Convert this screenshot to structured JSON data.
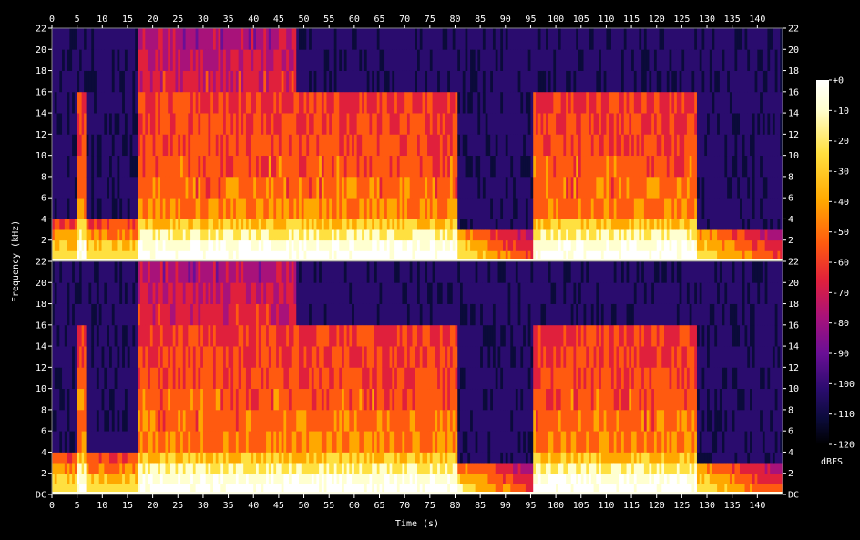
{
  "chart_data": {
    "type": "heatmap",
    "title": "",
    "xlabel": "Time (s)",
    "ylabel": "Frequency (kHz)",
    "colorbar_label": "dBFS",
    "xlim": [
      0,
      145
    ],
    "ylim_khz": [
      0,
      22
    ],
    "x_ticks": [
      0,
      5,
      10,
      15,
      20,
      25,
      30,
      35,
      40,
      45,
      50,
      55,
      60,
      65,
      70,
      75,
      80,
      85,
      90,
      95,
      100,
      105,
      110,
      115,
      120,
      125,
      130,
      135,
      140
    ],
    "y_tick_labels": [
      "DC",
      "2",
      "4",
      "6",
      "8",
      "10",
      "12",
      "14",
      "16",
      "18",
      "20",
      "22"
    ],
    "colorbar_ticks": [
      "+0",
      "-10",
      "-20",
      "-30",
      "-40",
      "-50",
      "-60",
      "-70",
      "-80",
      "-90",
      "-100",
      "-110",
      "-120"
    ],
    "colorbar_range_db": [
      -120,
      0
    ],
    "channels": 2,
    "colormap": [
      "#000000",
      "#0b0b3a",
      "#2a0c6e",
      "#6a0f96",
      "#a8127a",
      "#e0203c",
      "#ff5a10",
      "#ffa800",
      "#ffe040",
      "#ffffd0",
      "#ffffff"
    ],
    "segments": [
      {
        "start_s": 0,
        "end_s": 5,
        "bandwidth_khz": 3.8,
        "level": "quiet"
      },
      {
        "start_s": 5,
        "end_s": 6.8,
        "bandwidth_khz": 16,
        "level": "loud"
      },
      {
        "start_s": 6.8,
        "end_s": 17,
        "bandwidth_khz": 4,
        "level": "quiet"
      },
      {
        "start_s": 17,
        "end_s": 48.5,
        "bandwidth_khz": 22,
        "level": "loud"
      },
      {
        "start_s": 48.5,
        "end_s": 80.5,
        "bandwidth_khz": 16,
        "level": "loud"
      },
      {
        "start_s": 80.5,
        "end_s": 95.5,
        "bandwidth_khz": 3,
        "level": "fade"
      },
      {
        "start_s": 95.5,
        "end_s": 128,
        "bandwidth_khz": 16,
        "level": "loud"
      },
      {
        "start_s": 128,
        "end_s": 145,
        "bandwidth_khz": 2.5,
        "level": "fade"
      }
    ]
  }
}
